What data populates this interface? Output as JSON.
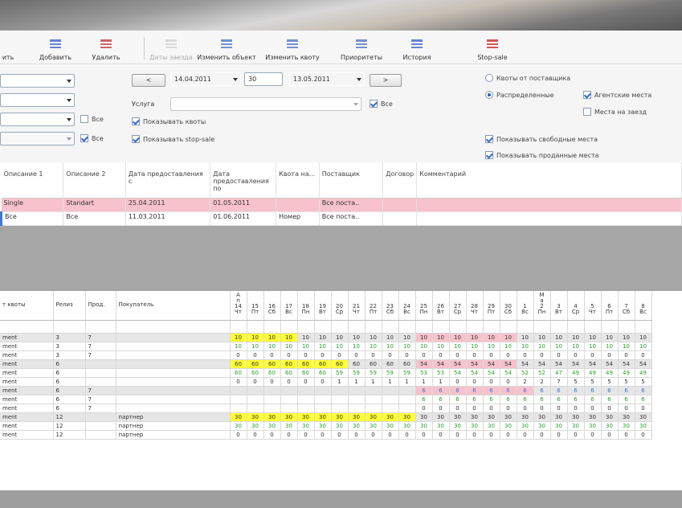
{
  "toolbar": {
    "items": [
      {
        "label": "ить",
        "name": "edit-button",
        "disabled": false
      },
      {
        "label": "Добавить",
        "name": "add-button",
        "disabled": false
      },
      {
        "label": "Удалить",
        "name": "delete-button",
        "disabled": false
      },
      {
        "label": "Даты заезда",
        "name": "arrival-dates-button",
        "disabled": true
      },
      {
        "label": "Изменить объект",
        "name": "edit-object-button",
        "disabled": false
      },
      {
        "label": "Изменить квоту",
        "name": "edit-quota-button",
        "disabled": false
      },
      {
        "label": "Приоритеты",
        "name": "priorities-button",
        "disabled": false
      },
      {
        "label": "История",
        "name": "history-button",
        "disabled": false
      },
      {
        "label": "Stop-sale",
        "name": "stop-sale-button",
        "disabled": false
      }
    ]
  },
  "filters": {
    "date_from": "14.04.2011",
    "days": "30",
    "date_to": "13.05.2011",
    "prev_label": "<",
    "next_label": ">",
    "service_label": "Услуга",
    "all_label": "Все",
    "show_quotas": "Показывать квоты",
    "show_stop_sale": "Показывать stop-sale",
    "supplier_quotas": "Квоты от поставщика",
    "distributed": "Распределенные",
    "agency_places": "Агентские места",
    "arrival_places": "Места на заезд",
    "show_free": "Показывать свободные места",
    "show_sold": "Показывать проданные места"
  },
  "quota_table": {
    "columns": [
      "Описание 1",
      "Описание 2",
      "Дата предоставления с",
      "Дата предоставления по",
      "Квота на...",
      "Поставщик",
      "Договор",
      "Комментарий"
    ],
    "rows": [
      {
        "c": [
          "Single",
          "Standart",
          "25.04.2011",
          "01.05.2011",
          "",
          "Все поста..",
          "",
          ""
        ],
        "highlight": true
      },
      {
        "c": [
          "Все",
          "Все",
          "11.03.2011",
          "01.06.2011",
          "Номер",
          "Все поста..",
          "",
          ""
        ],
        "highlight": false
      }
    ]
  },
  "alloc_table": {
    "fixed_headers": [
      "т квоты",
      "Релиз",
      "Прод.",
      "Покупатель"
    ],
    "months": [
      {
        "text": "А\nп\nр",
        "at": 0
      },
      {
        "text": "М\nа\nй",
        "at": 18
      }
    ],
    "day_nums": [
      "14",
      "15",
      "16",
      "17",
      "18",
      "19",
      "20",
      "21",
      "22",
      "23",
      "24",
      "25",
      "26",
      "27",
      "28",
      "29",
      "30",
      "1",
      "2",
      "3",
      "4",
      "5",
      "6",
      "7",
      "8"
    ],
    "day_names": [
      "Чт",
      "Пт",
      "Сб",
      "Вс",
      "Пн",
      "Вт",
      "Ср",
      "Чт",
      "Пт",
      "Сб",
      "Вс",
      "Пн",
      "Вт",
      "Ср",
      "Чт",
      "Пт",
      "Сб",
      "Вс",
      "Пн",
      "Вт",
      "Ср",
      "Чт",
      "Пт",
      "Сб",
      "Вс"
    ],
    "rows": [
      {
        "f": [
          "ment",
          "3",
          "7",
          ""
        ],
        "v": [
          "10",
          "10",
          "10",
          "10",
          "10",
          "10",
          "10",
          "10",
          "10",
          "10",
          "10",
          "10",
          "10",
          "10",
          "10",
          "10",
          "10",
          "10",
          "10",
          "10",
          "10",
          "10",
          "10",
          "10",
          "10"
        ],
        "type": "gray",
        "bg": "y4p5"
      },
      {
        "f": [
          "ment",
          "3",
          "7",
          ""
        ],
        "v": [
          "10",
          "10",
          "10",
          "10",
          "10",
          "10",
          "10",
          "10",
          "10",
          "10",
          "10",
          "10",
          "10",
          "10",
          "10",
          "10",
          "10",
          "10",
          "10",
          "10",
          "10",
          "10",
          "10",
          "10",
          "10"
        ],
        "type": "white",
        "color": "gr"
      },
      {
        "f": [
          "ment",
          "3",
          "7",
          ""
        ],
        "v": [
          "0",
          "0",
          "0",
          "0",
          "0",
          "0",
          "0",
          "0",
          "0",
          "0",
          "0",
          "0",
          "0",
          "0",
          "0",
          "0",
          "0",
          "0",
          "0",
          "0",
          "0",
          "0",
          "0",
          "0",
          "0"
        ],
        "type": "white"
      },
      {
        "f": [
          "ment",
          "6",
          "",
          ""
        ],
        "v": [
          "60",
          "60",
          "60",
          "60",
          "60",
          "60",
          "60",
          "60",
          "60",
          "60",
          "60",
          "54",
          "54",
          "54",
          "54",
          "54",
          "54",
          "54",
          "54",
          "54",
          "54",
          "54",
          "54",
          "54",
          "54"
        ],
        "type": "gray",
        "bg": "y7p6"
      },
      {
        "f": [
          "ment",
          "6",
          "",
          ""
        ],
        "v": [
          "60",
          "60",
          "60",
          "60",
          "60",
          "60",
          "59",
          "59",
          "59",
          "59",
          "59",
          "53",
          "53",
          "54",
          "54",
          "54",
          "54",
          "52",
          "52",
          "47",
          "49",
          "49",
          "49",
          "49",
          "49"
        ],
        "type": "white",
        "color": "gr"
      },
      {
        "f": [
          "ment",
          "6",
          "",
          ""
        ],
        "v": [
          "0",
          "0",
          "0",
          "0",
          "0",
          "0",
          "1",
          "1",
          "1",
          "1",
          "1",
          "1",
          "1",
          "0",
          "0",
          "0",
          "0",
          "2",
          "2",
          "7",
          "5",
          "5",
          "5",
          "5",
          "5"
        ],
        "type": "white"
      },
      {
        "f": [
          "ment",
          "6",
          "7",
          ""
        ],
        "v": [
          "",
          "",
          "",
          "",
          "",
          "",
          "",
          "",
          "",
          "",
          "",
          "6",
          "6",
          "6",
          "6",
          "6",
          "6",
          "6",
          "6",
          "6",
          "6",
          "6",
          "6",
          "6",
          "6"
        ],
        "type": "gray",
        "bg": "p6",
        "color": "bl"
      },
      {
        "f": [
          "ment",
          "6",
          "7",
          ""
        ],
        "v": [
          "",
          "",
          "",
          "",
          "",
          "",
          "",
          "",
          "",
          "",
          "",
          "6",
          "6",
          "6",
          "6",
          "6",
          "6",
          "6",
          "6",
          "6",
          "6",
          "6",
          "6",
          "6",
          "6"
        ],
        "type": "white",
        "color": "gr"
      },
      {
        "f": [
          "ment",
          "6",
          "7",
          ""
        ],
        "v": [
          "",
          "",
          "",
          "",
          "",
          "",
          "",
          "",
          "",
          "",
          "",
          "0",
          "0",
          "0",
          "0",
          "0",
          "0",
          "0",
          "0",
          "0",
          "0",
          "0",
          "0",
          "0",
          "0"
        ],
        "type": "white"
      },
      {
        "f": [
          "ment",
          "12",
          "",
          "партнер"
        ],
        "v": [
          "30",
          "30",
          "30",
          "30",
          "30",
          "30",
          "30",
          "30",
          "30",
          "30",
          "30",
          "30",
          "30",
          "30",
          "30",
          "30",
          "30",
          "30",
          "30",
          "30",
          "30",
          "30",
          "30",
          "30",
          "30"
        ],
        "type": "gray",
        "bg": "y11"
      },
      {
        "f": [
          "ment",
          "12",
          "",
          "партнер"
        ],
        "v": [
          "30",
          "30",
          "30",
          "30",
          "30",
          "30",
          "30",
          "30",
          "30",
          "30",
          "30",
          "30",
          "30",
          "30",
          "30",
          "30",
          "30",
          "30",
          "30",
          "30",
          "30",
          "30",
          "30",
          "30",
          "30"
        ],
        "type": "white",
        "color": "gr"
      },
      {
        "f": [
          "ment",
          "12",
          "",
          "партнер"
        ],
        "v": [
          "0",
          "0",
          "0",
          "0",
          "0",
          "0",
          "0",
          "0",
          "0",
          "0",
          "0",
          "0",
          "0",
          "0",
          "0",
          "0",
          "0",
          "0",
          "0",
          "0",
          "0",
          "0",
          "0",
          "0",
          "0"
        ],
        "type": "white"
      }
    ]
  }
}
